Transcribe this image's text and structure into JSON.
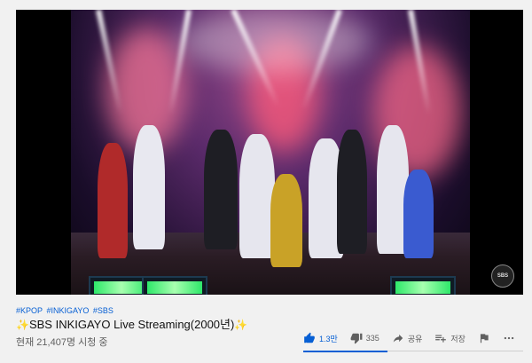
{
  "video": {
    "watermark_text": "SBS",
    "accent": "#065fd4"
  },
  "tags": [
    "#KPOP",
    "#INKIGAYO",
    "#SBS"
  ],
  "title": {
    "prefix_sparkle": "✨",
    "text": "SBS INKIGAYO Live Streaming(2000년)",
    "suffix_sparkle": "✨"
  },
  "views": "현재 21,407명 시청 중",
  "actions": {
    "like_count": "1.3만",
    "dislike_count": "335",
    "share_label": "공유",
    "save_label": "저장",
    "icons": [
      "thumbs-up-icon",
      "thumbs-down-icon",
      "share-icon",
      "playlist-add-icon",
      "flag-icon",
      "more-icon"
    ]
  }
}
